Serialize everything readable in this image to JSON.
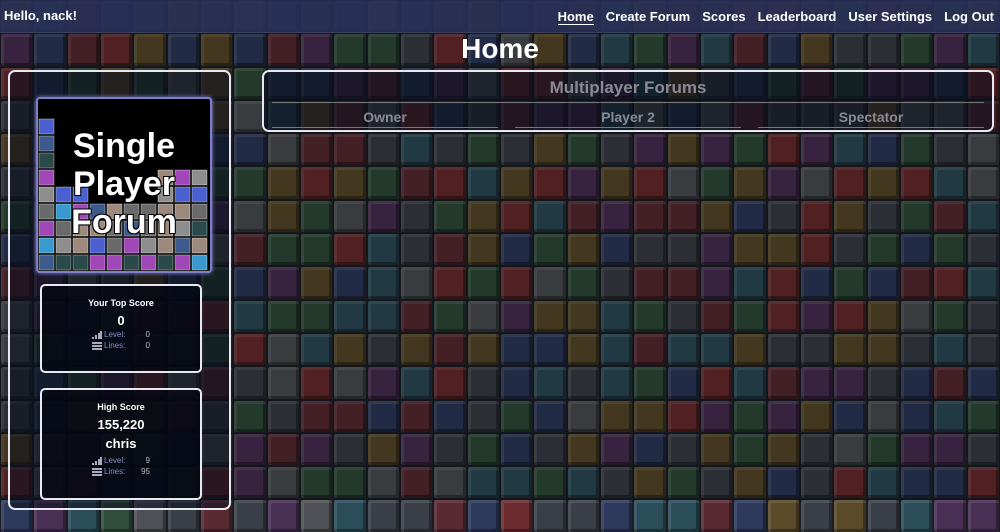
{
  "nav": {
    "greeting": "Hello, nack!",
    "links": [
      "Home",
      "Create Forum",
      "Scores",
      "Leaderboard",
      "User Settings",
      "Log Out"
    ],
    "active": "Home"
  },
  "page": {
    "title": "Home"
  },
  "single_player": {
    "label_line1": "Single",
    "label_line2": "Player",
    "label_line3": "Forum"
  },
  "top_score": {
    "title": "Your Top Score",
    "score": "0",
    "level_label": "Level:",
    "level": "0",
    "lines_label": "Lines:",
    "lines": "0"
  },
  "high_score": {
    "title": "High Score",
    "score": "155,220",
    "player": "chris",
    "level_label": "Level:",
    "level": "9",
    "lines_label": "Lines:",
    "lines": "95"
  },
  "multiplayer": {
    "title": "Multiplayer Forums",
    "columns": [
      "Owner",
      "Player 2",
      "Spectator"
    ]
  },
  "colors": {
    "tile_palette": [
      "#3a3f47",
      "#5a2a33",
      "#2d3a5c",
      "#2f4d3a",
      "#5a4a2a",
      "#2b4d5a",
      "#4a2f55",
      "#4d5054",
      "#6b2b2f"
    ]
  }
}
